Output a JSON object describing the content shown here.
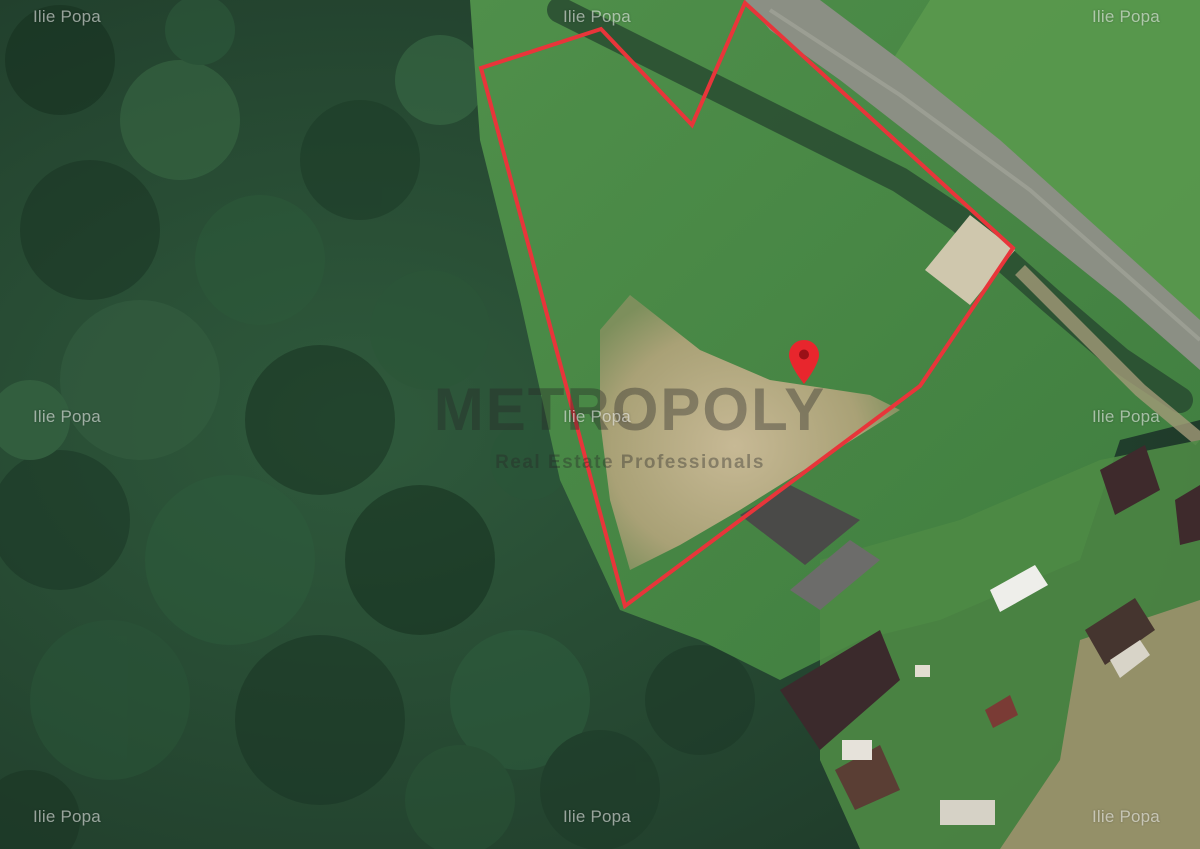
{
  "watermarks": {
    "top_left": "Ilie Popa",
    "top_center": "Ilie Popa",
    "top_right": "Ilie Popa",
    "middle_left": "Ilie Popa",
    "middle_center": "Ilie Popa",
    "middle_right": "Ilie Popa",
    "bottom_left": "Ilie Popa",
    "bottom_center": "Ilie Popa",
    "bottom_right": "Ilie Popa"
  },
  "logo": {
    "name": "METROPOLY",
    "tagline": "Real Estate Professionals"
  },
  "map": {
    "type": "satellite",
    "pin_icon": "location-pin-icon",
    "boundary_color": "#e8353a",
    "pin_color": "#e8262d"
  }
}
